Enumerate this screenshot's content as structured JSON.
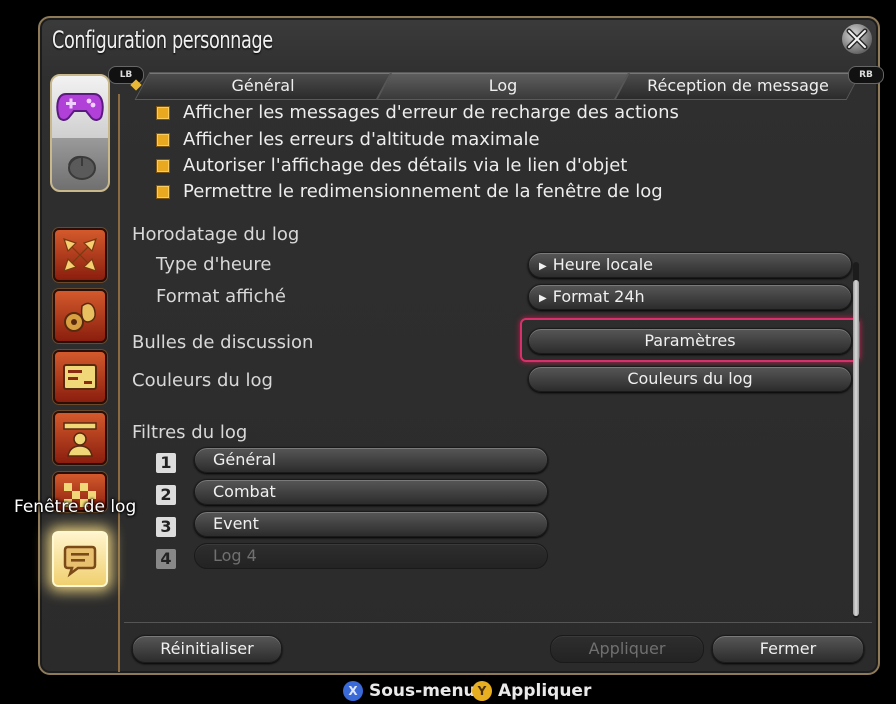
{
  "window": {
    "title": "Configuration personnage"
  },
  "tabs": {
    "left_badge": "LB",
    "right_badge": "RB",
    "items": [
      {
        "label": "Général"
      },
      {
        "label": "Log"
      },
      {
        "label": "Réception de message"
      }
    ]
  },
  "sidebar": {
    "tooltip": "Fenêtre de log",
    "icons": [
      "gamepad-icon",
      "mouse-icon",
      "arrows-icon",
      "gear-bag-icon",
      "card-icon",
      "character-icon",
      "checkered-icon",
      "chat-log-icon"
    ]
  },
  "checks": [
    {
      "label": "Afficher les messages d'erreur de recharge des actions"
    },
    {
      "label": "Afficher les erreurs d'altitude maximale"
    },
    {
      "label": "Autoriser l'affichage des détails via le lien d'objet"
    },
    {
      "label": "Permettre le redimensionnement de la fenêtre de log"
    }
  ],
  "timestamp": {
    "title": "Horodatage du log",
    "time_type_label": "Type d'heure",
    "time_type_value": "Heure locale",
    "format_label": "Format affiché",
    "format_value": "Format 24h"
  },
  "bubbles": {
    "label": "Bulles de discussion",
    "button": "Paramètres"
  },
  "colors": {
    "label": "Couleurs du log",
    "button": "Couleurs du log"
  },
  "filters": {
    "title": "Filtres du log",
    "items": [
      {
        "num": "1",
        "label": "Général",
        "enabled": true
      },
      {
        "num": "2",
        "label": "Combat",
        "enabled": true
      },
      {
        "num": "3",
        "label": "Event",
        "enabled": true
      },
      {
        "num": "4",
        "label": "Log 4",
        "enabled": false
      }
    ]
  },
  "buttons": {
    "reset": "Réinitialiser",
    "apply": "Appliquer",
    "close": "Fermer"
  },
  "hints": [
    {
      "key": "X",
      "label": "Sous-menu",
      "color": "#3a6ad8"
    },
    {
      "key": "Y",
      "label": "Appliquer",
      "color": "#e8b020"
    }
  ],
  "colors_theme": {
    "focus": "#d8306a",
    "check": "#e8a820",
    "frame": "#8e7a57"
  }
}
